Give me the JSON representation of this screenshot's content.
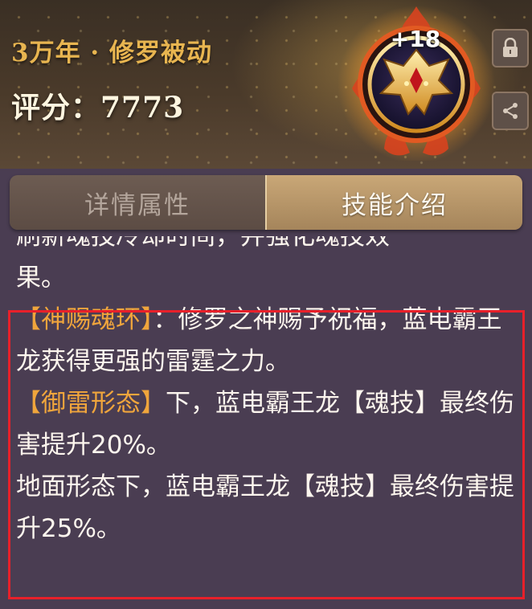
{
  "header": {
    "subtitle": "3万年 · 修罗被动",
    "score": "评分：7773",
    "level_badge": "+18",
    "icons": [
      "lock-icon",
      "share-icon"
    ],
    "emblem": "shura-soul-ring-emblem"
  },
  "tabs": [
    {
      "label": "详情属性",
      "active": false
    },
    {
      "label": "技能介绍",
      "active": true
    }
  ],
  "description": {
    "partial_line_1": "刷新魂技冷却时间，并强化魂技效",
    "partial_line_2": "果。",
    "para1_tag": "【神赐魂环】",
    "para1_text": "：修罗之神赐予祝福，蓝电霸王龙获得更强的雷霆之力。",
    "para2_tag": "【御雷形态】",
    "para2_text": "下，蓝电霸王龙【魂技】最终伤害提升20%。",
    "para3_text": "地面形态下，蓝电霸王龙【魂技】最终伤害提升25%。"
  },
  "colors": {
    "accent_gold": "#e8b550",
    "tag_orange": "#f0a53c",
    "highlight_border": "#e8202a"
  }
}
